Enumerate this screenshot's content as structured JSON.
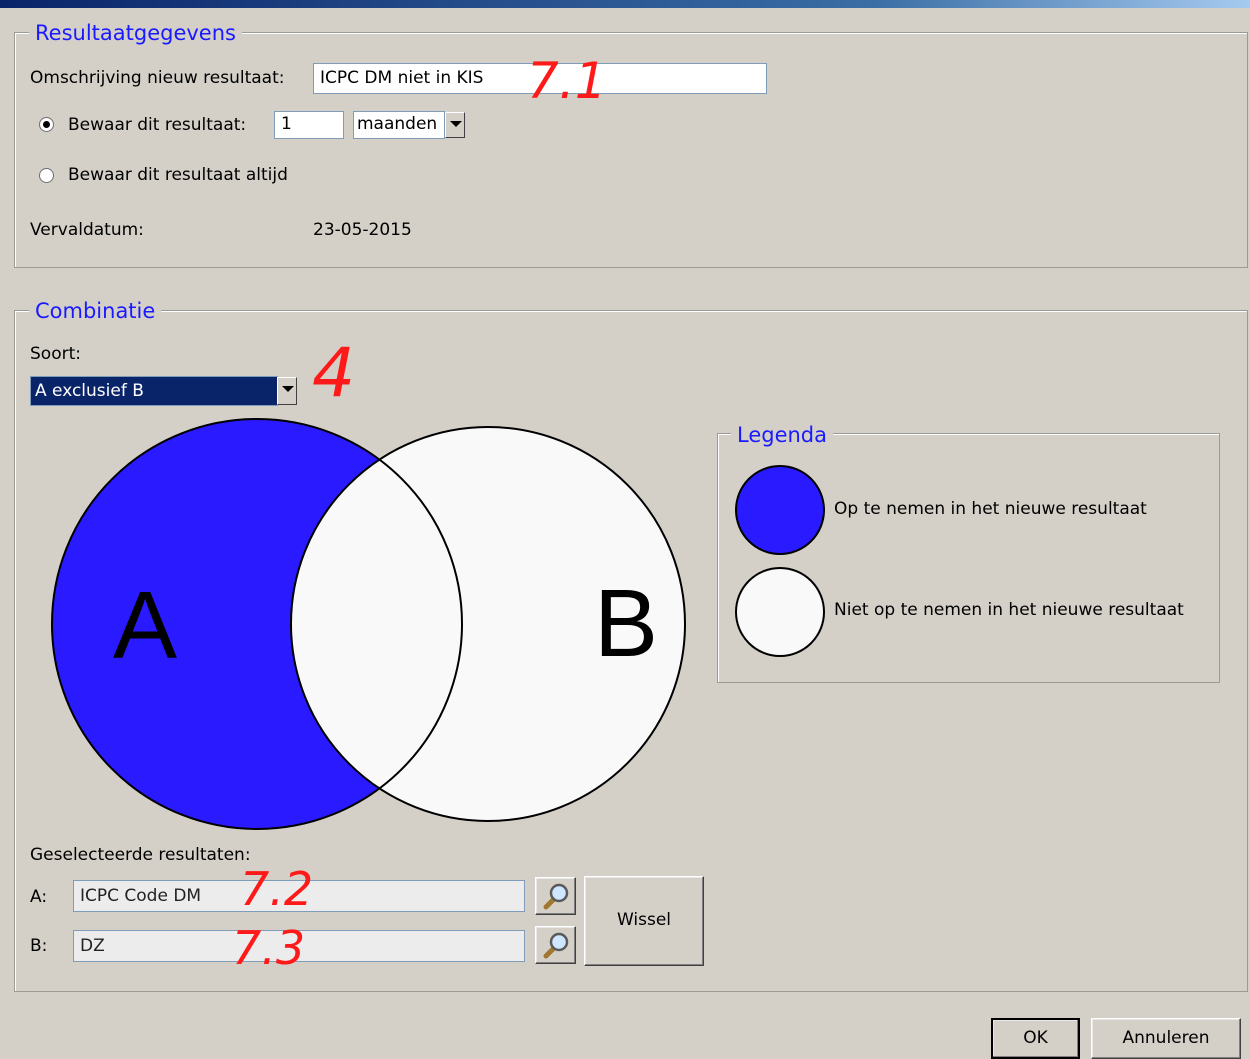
{
  "resultaat": {
    "title": "Resultaatgegevens",
    "omschrijving_label": "Omschrijving nieuw resultaat:",
    "omschrijving_value": "ICPC DM niet in KIS",
    "bewaar_label": "Bewaar dit resultaat:",
    "bewaar_value": "1",
    "bewaar_unit": "maanden",
    "bewaar_altijd_label": "Bewaar dit resultaat altijd",
    "vervaldatum_label": "Vervaldatum:",
    "vervaldatum_value": "23-05-2015"
  },
  "combinatie": {
    "title": "Combinatie",
    "soort_label": "Soort:",
    "soort_value": "A exclusief B",
    "venn": {
      "label_a": "A",
      "label_b": "B",
      "fill_included": "#2a1aff",
      "fill_excluded": "#f9f9f9"
    },
    "legenda": {
      "title": "Legenda",
      "included_label": "Op te nemen in het nieuwe resultaat",
      "excluded_label": "Niet op te nemen in het nieuwe resultaat"
    },
    "geselecteerde_label": "Geselecteerde resultaten:",
    "a_label": "A:",
    "a_value": "ICPC Code DM",
    "b_label": "B:",
    "b_value": "DZ",
    "wissel_label": "Wissel"
  },
  "footer": {
    "ok_label": "OK",
    "cancel_label": "Annuleren"
  },
  "annotations": [
    "7.1",
    "4",
    "7.2",
    "7.3"
  ]
}
